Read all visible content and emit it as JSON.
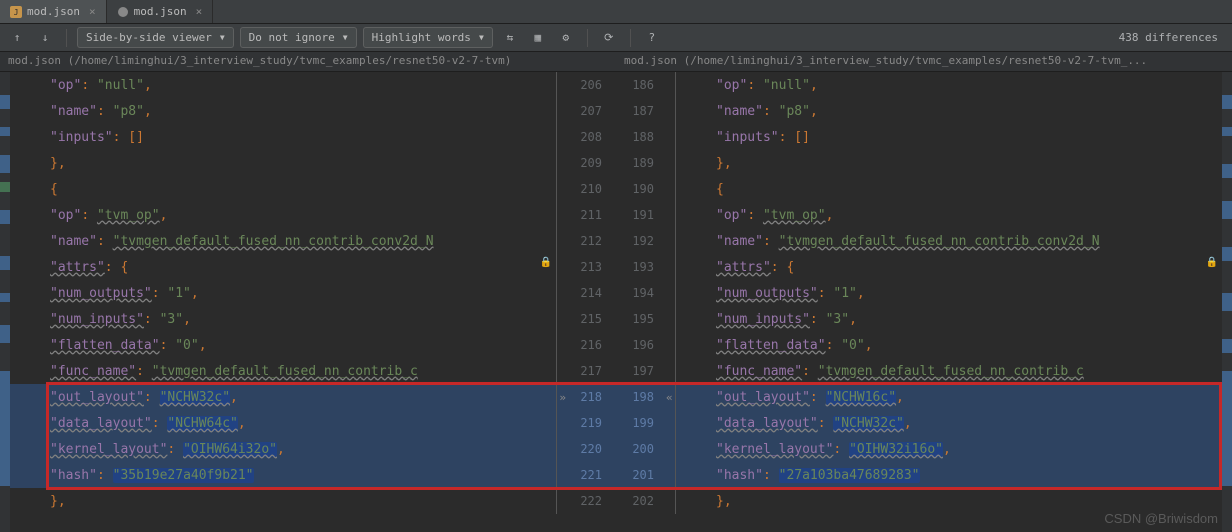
{
  "tabs": [
    {
      "name": "mod.json",
      "icon": "json-icon",
      "active": true
    },
    {
      "name": "mod.json",
      "icon": "diff-icon",
      "active": false
    }
  ],
  "toolbar": {
    "viewer": "Side-by-side viewer",
    "ignore": "Do not ignore",
    "highlight": "Highlight words",
    "diff_count": "438 differences"
  },
  "paths": {
    "left": "mod.json (/home/liminghui/3_interview_study/tvmc_examples/resnet50-v2-7-tvm)",
    "right": "mod.json (/home/liminghui/3_interview_study/tvmc_examples/resnet50-v2-7-tvm_..."
  },
  "lines": {
    "left_ln": [
      206,
      207,
      208,
      209,
      210,
      211,
      212,
      213,
      214,
      215,
      216,
      217,
      218,
      219,
      220,
      221,
      222
    ],
    "right_ln": [
      186,
      187,
      188,
      189,
      190,
      191,
      192,
      193,
      194,
      195,
      196,
      197,
      198,
      199,
      200,
      201,
      202
    ]
  },
  "content": {
    "op_label": "\"op\"",
    "null_val": "\"null\"",
    "name_label": "\"name\"",
    "p8_val": "\"p8\"",
    "inputs_label": "\"inputs\"",
    "tvm_op": "\"tvm_op\"",
    "fn_name_left": "\"tvmgen_default_fused_nn_contrib_conv2d_N",
    "fn_name_right": "\"tvmgen_default_fused_nn_contrib_conv2d_N",
    "attrs_label": "\"attrs\"",
    "num_outputs_label": "\"num_outputs\"",
    "num_outputs_val": "\"1\"",
    "num_inputs_label": "\"num_inputs\"",
    "num_inputs_val": "\"3\"",
    "flatten_label": "\"flatten_data\"",
    "flatten_val": "\"0\"",
    "func_name_label": "\"func_name\"",
    "func_val_left": "\"tvmgen_default_fused_nn_contrib_c",
    "func_val_right": "\"tvmgen_default_fused_nn_contrib_c",
    "out_layout_label": "\"out_layout\"",
    "out_layout_left": "\"NCHW32c\"",
    "out_layout_right": "\"NCHW16c\"",
    "data_layout_label": "\"data_layout\"",
    "data_layout_left": "\"NCHW64c\"",
    "data_layout_right": "\"NCHW32c\"",
    "kernel_layout_label": "\"kernel_layout\"",
    "kernel_left": "\"OIHW64i32o\"",
    "kernel_right": "\"OIHW32i16o\"",
    "hash_label": "\"hash\"",
    "hash_left": "\"35b19e27a40f9b21\"",
    "hash_right": "\"27a103ba47689283\""
  },
  "watermark": "CSDN @Briwisdom"
}
